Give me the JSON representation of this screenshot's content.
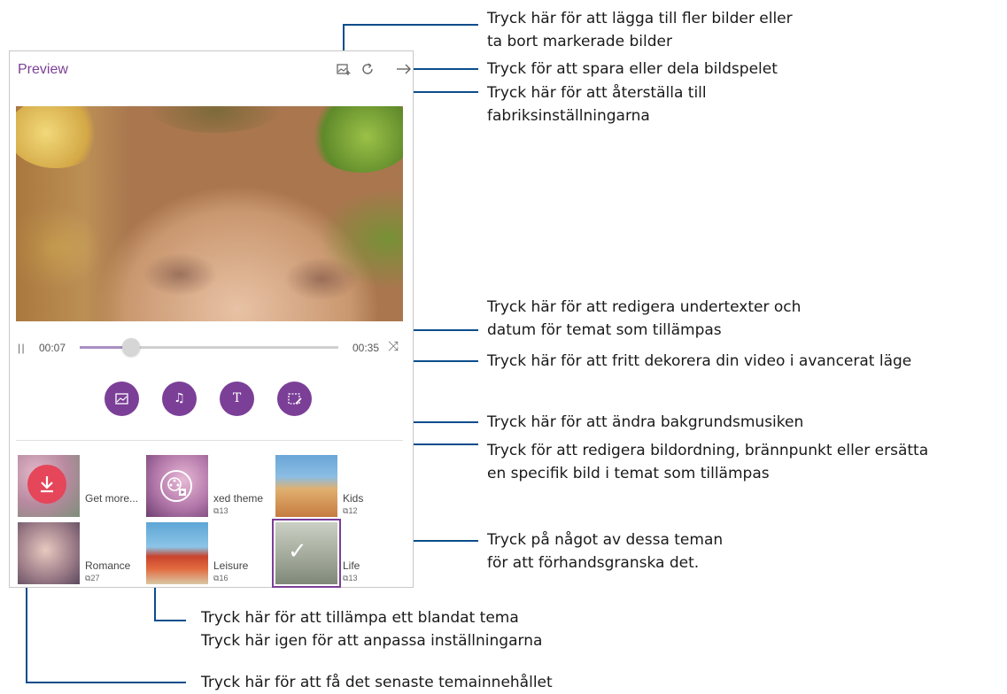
{
  "app": {
    "title": "Preview",
    "toolbar_icons": [
      "add-photo-icon",
      "reset-icon",
      "share-arrow-icon"
    ]
  },
  "player": {
    "current_time": "00:07",
    "end_time": "00:35",
    "progress": 0.2,
    "pause_glyph": "| |",
    "shuffle_glyph": "⤨"
  },
  "tools": [
    {
      "icon": "photo-icon",
      "glyph": "🖼"
    },
    {
      "icon": "music-note-icon",
      "glyph": "♫"
    },
    {
      "icon": "text-icon",
      "glyph": "T"
    },
    {
      "icon": "decorate-icon",
      "glyph": "✎"
    }
  ],
  "themes": [
    {
      "name": "Get more...",
      "count": ""
    },
    {
      "name": "xed theme",
      "count": "13"
    },
    {
      "name": "Kids",
      "count": "12"
    },
    {
      "name": "Romance",
      "count": "27"
    },
    {
      "name": "Leisure",
      "count": "16"
    },
    {
      "name": "Life",
      "count": "13"
    }
  ],
  "callouts": {
    "add_remove_1": "Tryck här för att lägga till fler bilder eller",
    "add_remove_2": "ta bort markerade bilder",
    "save_share": "Tryck för att spara eller dela bildspelet",
    "reset_1": "Tryck här för att återställa till",
    "reset_2": "fabriksinställningarna",
    "subtitles_1": "Tryck här för att redigera undertexter och",
    "subtitles_2": "datum för temat som tillämpas",
    "decorate": "Tryck här för att fritt dekorera din video i avancerat läge",
    "music": "Tryck här för att ändra bakgrundsmusiken",
    "photo_order_1": "Tryck för att redigera bildordning, brännpunkt eller ersätta",
    "photo_order_2": "en specifik bild i temat som tillämpas",
    "themes_1": "Tryck på något av dessa teman",
    "themes_2": "för att förhandsgranska det.",
    "mixed_1": "Tryck här för att tillämpa ett blandat tema",
    "mixed_2": "Tryck här igen för att anpassa inställningarna",
    "latest": "Tryck här för att få det senaste temainnehållet"
  },
  "colors": {
    "accent": "#7b3f98",
    "callout_line": "#0a4d8c",
    "download": "#e5465a"
  }
}
